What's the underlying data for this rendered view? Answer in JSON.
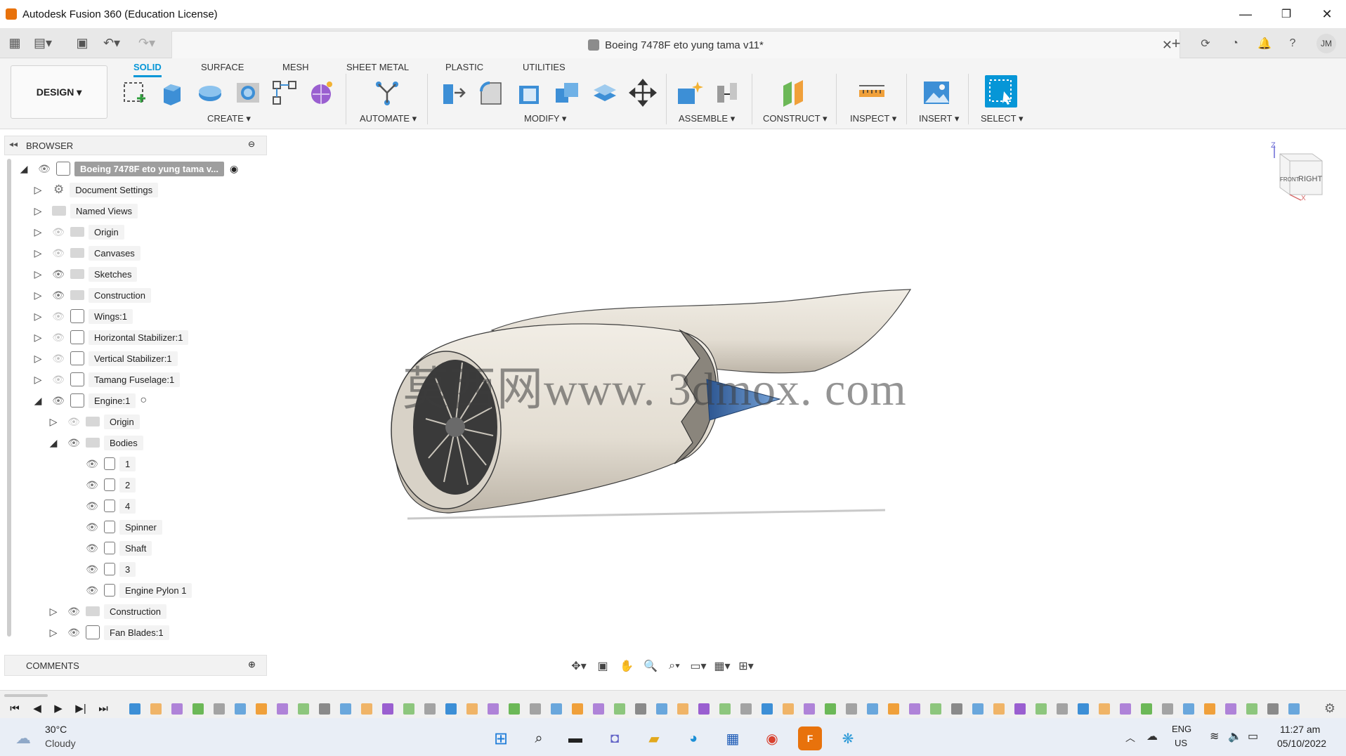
{
  "window": {
    "title": "Autodesk Fusion 360 (Education License)",
    "minimize_glyph": "—",
    "restore_glyph": "❐",
    "close_glyph": "✕"
  },
  "document": {
    "tab_title": "Boeing 7478F eto yung tama v11*"
  },
  "user": {
    "initials": "JM"
  },
  "workspace": {
    "label": "DESIGN ▾"
  },
  "ribbon": {
    "tabs": [
      "SOLID",
      "SURFACE",
      "MESH",
      "SHEET METAL",
      "PLASTIC",
      "UTILITIES"
    ],
    "active_tab": "SOLID",
    "groups": [
      "CREATE ▾",
      "AUTOMATE ▾",
      "MODIFY ▾",
      "ASSEMBLE ▾",
      "CONSTRUCT ▾",
      "INSPECT ▾",
      "INSERT ▾",
      "SELECT ▾"
    ]
  },
  "browser": {
    "title": "BROWSER",
    "root": "Boeing 7478F eto yung tama v...",
    "items": [
      {
        "label": "Document Settings"
      },
      {
        "label": "Named Views"
      },
      {
        "label": "Origin"
      },
      {
        "label": "Canvases"
      },
      {
        "label": "Sketches"
      },
      {
        "label": "Construction"
      },
      {
        "label": "Wings:1"
      },
      {
        "label": "Horizontal Stabilizer:1"
      },
      {
        "label": "Vertical Stabilizer:1"
      },
      {
        "label": "Tamang Fuselage:1"
      },
      {
        "label": "Engine:1"
      },
      {
        "label": "Origin"
      },
      {
        "label": "Bodies"
      },
      {
        "label": "1"
      },
      {
        "label": "2"
      },
      {
        "label": "4"
      },
      {
        "label": "Spinner"
      },
      {
        "label": "Shaft"
      },
      {
        "label": "3"
      },
      {
        "label": "Engine Pylon 1"
      },
      {
        "label": "Construction"
      },
      {
        "label": "Fan Blades:1"
      }
    ]
  },
  "comments": {
    "title": "COMMENTS"
  },
  "viewcube": {
    "front": "FRONT",
    "right": "RIGHT",
    "z_axis": "Z",
    "x_axis": "X"
  },
  "watermark": "莫西网www. 3dmox. com",
  "taskbar": {
    "temperature": "30°C",
    "weather": "Cloudy",
    "lang": "ENG",
    "region": "US",
    "time": "11:27 am",
    "date": "05/10/2022"
  },
  "colors": {
    "accent": "#0696d7",
    "engine_body": "#e6e1d8",
    "spinner": "#3d6fb0"
  }
}
